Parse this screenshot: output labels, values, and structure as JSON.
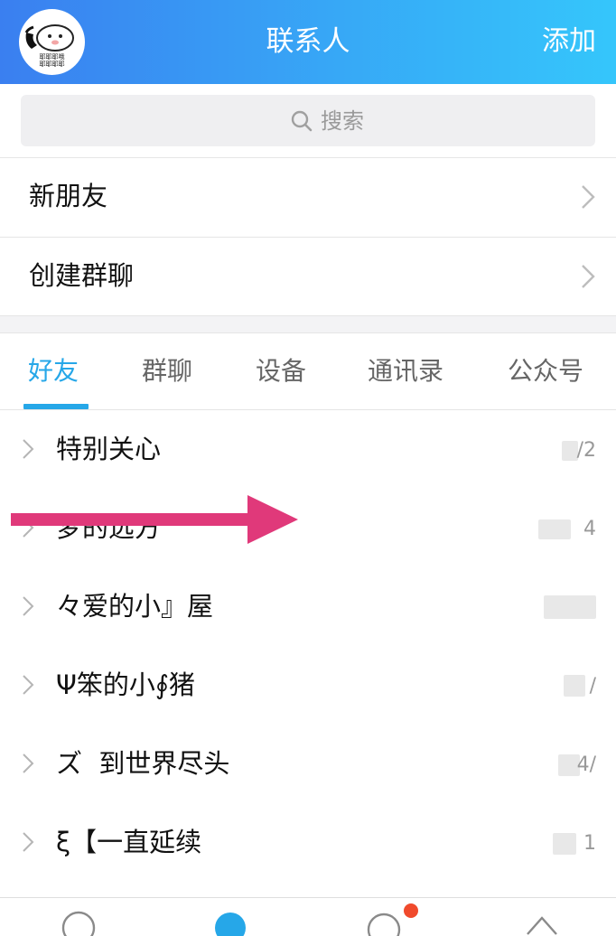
{
  "header": {
    "title": "联系人",
    "add_label": "添加",
    "avatar_caption_line1": "耶耶耶哦",
    "avatar_caption_line2": "耶耶耶耶"
  },
  "search": {
    "placeholder": "搜索",
    "icon": "search-icon"
  },
  "entries": [
    {
      "label": "新朋友",
      "icon": "chevron-right-icon"
    },
    {
      "label": "创建群聊",
      "icon": "chevron-right-icon"
    }
  ],
  "tabs": [
    {
      "label": "好友",
      "active": true
    },
    {
      "label": "群聊",
      "active": false
    },
    {
      "label": "设备",
      "active": false
    },
    {
      "label": "通讯录",
      "active": false
    },
    {
      "label": "公众号",
      "active": false
    }
  ],
  "groups": [
    {
      "name": "特别关心",
      "count": "/2"
    },
    {
      "name": "梦的远方",
      "count": "4"
    },
    {
      "name": "々爱的小』屋",
      "count": ""
    },
    {
      "name": "Ψ笨的小∮猪",
      "count": "/"
    },
    {
      "name": "ズ  到世界尽头",
      "count": "4/"
    },
    {
      "name": "ξ【一直延续",
      "count": "1"
    }
  ],
  "colors": {
    "accent": "#26a7e8",
    "header_start": "#3a7ff0",
    "header_end": "#35c6fb",
    "annotation_arrow": "#e0397a",
    "badge": "#f04a2c"
  },
  "tabbar": {
    "icons": [
      "message-icon",
      "contacts-icon",
      "dynamic-icon",
      "more-icon"
    ]
  }
}
